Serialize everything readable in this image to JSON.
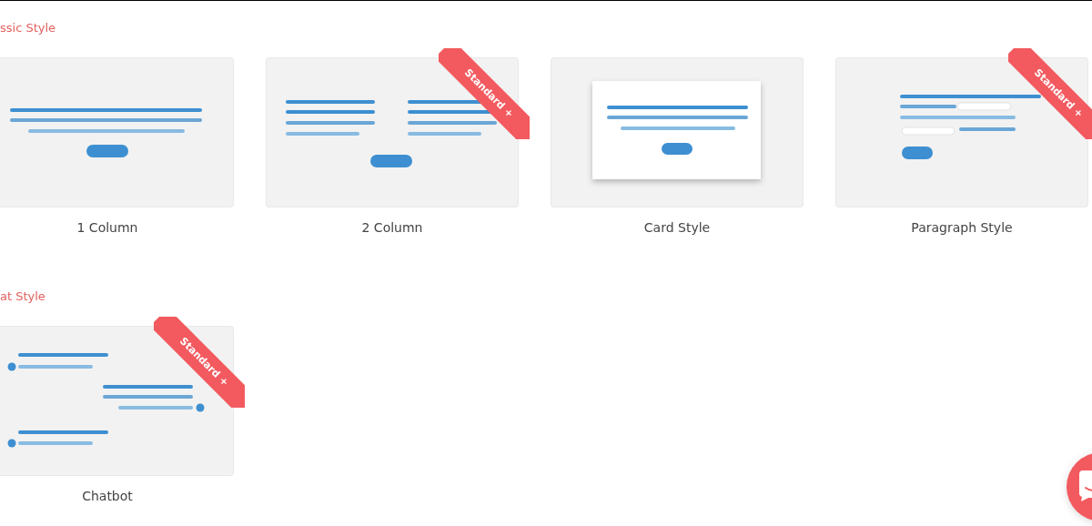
{
  "sections": [
    {
      "heading": "ssic Style",
      "templates": [
        {
          "label": "1 Column",
          "kind": "one_column"
        },
        {
          "label": "2 Column",
          "kind": "two_column",
          "ribbon": "Standard +"
        },
        {
          "label": "Card Style",
          "kind": "card"
        },
        {
          "label": "Paragraph Style",
          "kind": "paragraph",
          "ribbon": "Standard +"
        }
      ]
    },
    {
      "heading": "at Style",
      "templates": [
        {
          "label": "Chatbot",
          "kind": "chatbot",
          "ribbon": "Standard +"
        }
      ]
    }
  ]
}
